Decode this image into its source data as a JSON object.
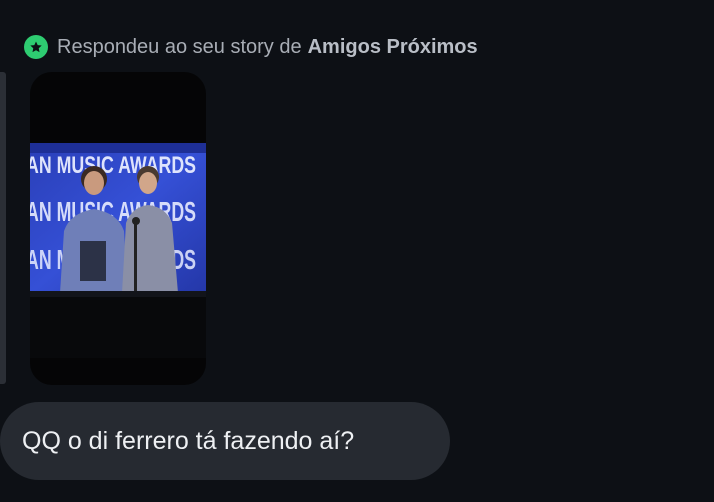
{
  "reply_header": {
    "prefix": "Respondeu ao seu story de",
    "list_name": "Amigos Próximos",
    "icon": "star-icon",
    "badge_color": "#2ecc71"
  },
  "story": {
    "banner_text": "AN MUSIC AWARDS"
  },
  "message": {
    "text": "QQ o di ferrero tá fazendo aí?"
  },
  "colors": {
    "background": "#0d1015",
    "bubble": "#262a31",
    "text_primary": "#eef0f3",
    "text_secondary": "#a8adb5"
  }
}
